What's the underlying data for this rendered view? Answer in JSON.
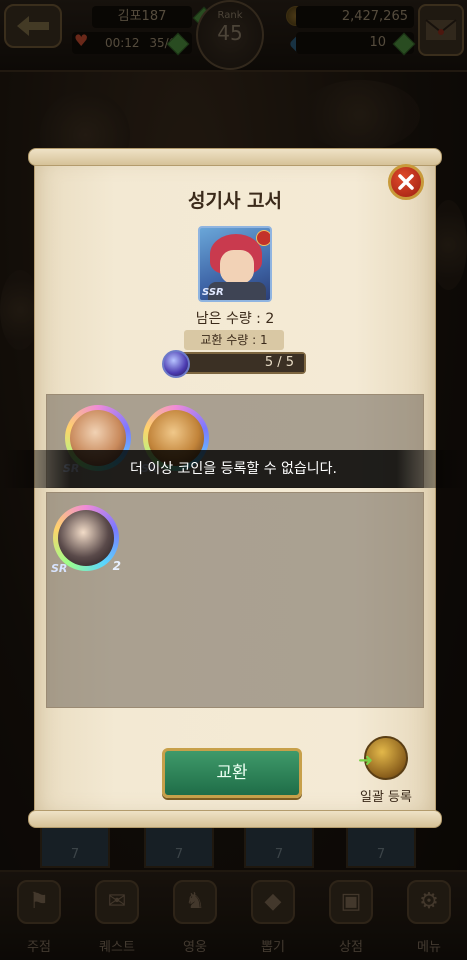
{
  "hud": {
    "player_name": "김포187",
    "stamina_time": "00:12",
    "stamina_count": "35/64",
    "rank_label": "Rank",
    "rank_value": "45",
    "gold": "2,427,265",
    "gems": "10"
  },
  "dialog": {
    "title": "성기사 고서",
    "remaining_label": "남은 수량 : 2",
    "exchange_count_label": "교환 수량 : 1",
    "progress_text": "5 / 5",
    "progress_fraction": 1.0,
    "portrait_rarity": "SSR",
    "selected_coins": [
      {
        "rarity": "SR"
      },
      {
        "rarity": "SR"
      }
    ],
    "owned_coins": [
      {
        "rarity": "SR",
        "level": "2"
      }
    ],
    "toast_message": "더 이상 코인을 등록할 수 없습니다.",
    "exchange_button": "교환",
    "bulk_register_button": "일괄 등록"
  },
  "bottom_cards": [
    {
      "count": "7"
    },
    {
      "count": "7"
    },
    {
      "count": "7"
    },
    {
      "count": "7"
    }
  ],
  "nav": [
    {
      "label": "주점",
      "icon": "tavern-icon"
    },
    {
      "label": "퀘스트",
      "icon": "quest-icon"
    },
    {
      "label": "영웅",
      "icon": "hero-icon"
    },
    {
      "label": "뽑기",
      "icon": "draw-icon"
    },
    {
      "label": "상점",
      "icon": "shop-icon"
    },
    {
      "label": "메뉴",
      "icon": "menu-icon"
    }
  ],
  "colors": {
    "parchment": "#f3e9d3",
    "exchange_button": "#2f8a5c",
    "close_button": "#c9321c"
  }
}
